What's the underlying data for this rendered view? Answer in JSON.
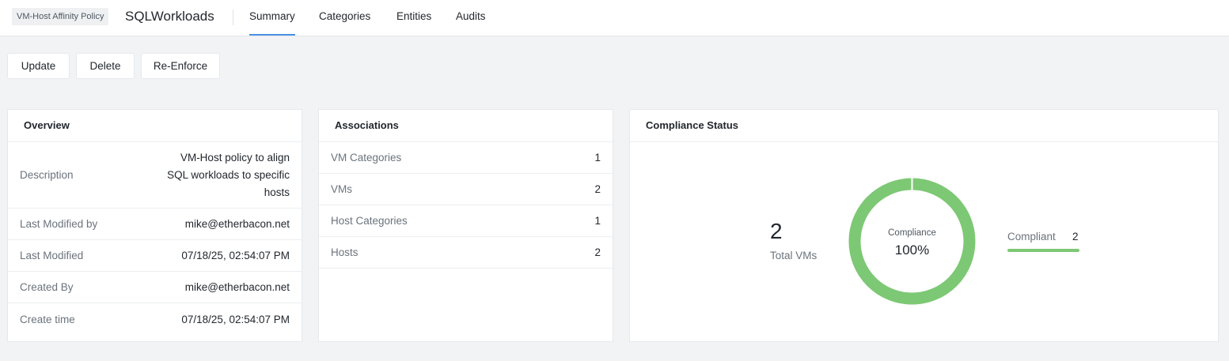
{
  "header": {
    "type_label": "VM-Host Affinity Policy",
    "title": "SQLWorkloads",
    "tabs": [
      {
        "label": "Summary",
        "active": true
      },
      {
        "label": "Categories",
        "active": false
      },
      {
        "label": "Entities",
        "active": false
      },
      {
        "label": "Audits",
        "active": false
      }
    ]
  },
  "actions": {
    "update": "Update",
    "delete": "Delete",
    "reenforce": "Re-Enforce"
  },
  "overview": {
    "title": "Overview",
    "rows": [
      {
        "label": "Description",
        "value": "VM-Host policy to align SQL workloads to specific hosts"
      },
      {
        "label": "Last Modified by",
        "value": "mike@etherbacon.net"
      },
      {
        "label": "Last Modified",
        "value": "07/18/25, 02:54:07 PM"
      },
      {
        "label": "Created By",
        "value": "mike@etherbacon.net"
      },
      {
        "label": "Create time",
        "value": "07/18/25, 02:54:07 PM"
      }
    ]
  },
  "associations": {
    "title": "Associations",
    "rows": [
      {
        "label": "VM Categories",
        "value": "1"
      },
      {
        "label": "VMs",
        "value": "2"
      },
      {
        "label": "Host Categories",
        "value": "1"
      },
      {
        "label": "Hosts",
        "value": "2"
      }
    ]
  },
  "compliance": {
    "title": "Compliance Status",
    "total_value": "2",
    "total_label": "Total VMs",
    "donut_label": "Compliance",
    "donut_value": "100%",
    "compliant_fraction": 1.0,
    "legend": [
      {
        "label": "Compliant",
        "value": "2"
      }
    ],
    "colors": {
      "compliant": "#7dc874"
    }
  }
}
